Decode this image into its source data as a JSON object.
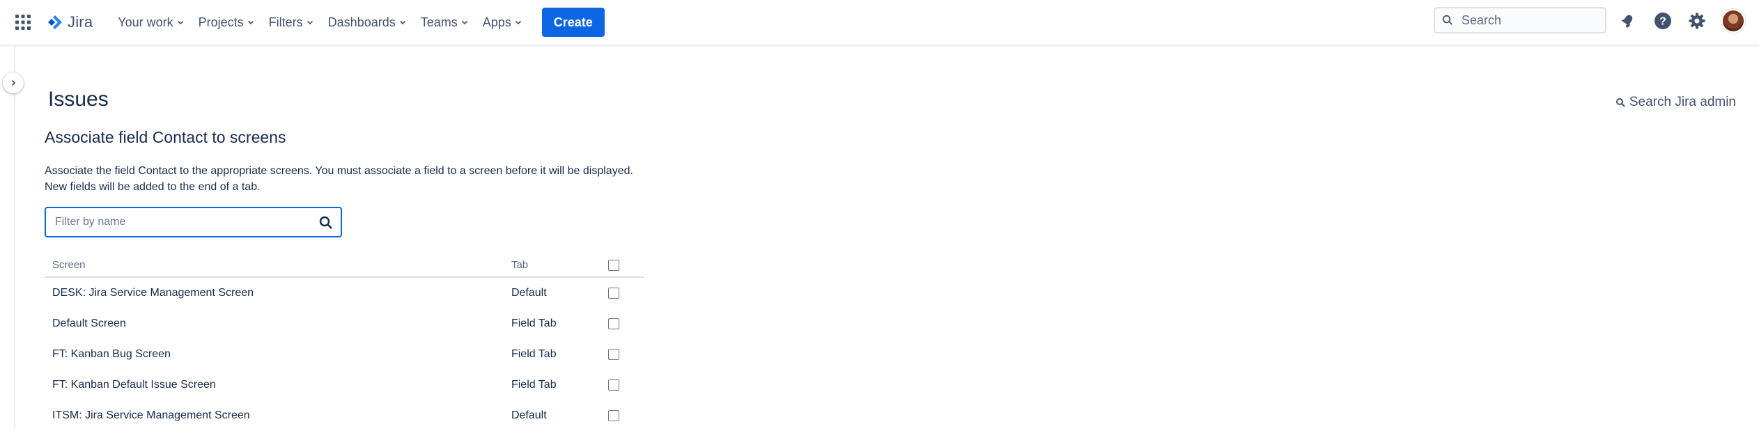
{
  "nav": {
    "logo": "Jira",
    "items": [
      {
        "label": "Your work"
      },
      {
        "label": "Projects"
      },
      {
        "label": "Filters"
      },
      {
        "label": "Dashboards"
      },
      {
        "label": "Teams"
      },
      {
        "label": "Apps"
      }
    ],
    "create_label": "Create",
    "search_placeholder": "Search"
  },
  "page": {
    "title": "Issues",
    "admin_search": "Search Jira admin",
    "section_title": "Associate field Contact to screens",
    "description_line1": "Associate the field Contact to the appropriate screens. You must associate a field to a screen before it will be displayed.",
    "description_line2": "New fields will be added to the end of a tab.",
    "filter_placeholder": "Filter by name"
  },
  "table": {
    "headers": {
      "screen": "Screen",
      "tab": "Tab"
    },
    "rows": [
      {
        "screen": "DESK: Jira Service Management Screen",
        "tab": "Default",
        "checked": false
      },
      {
        "screen": "Default Screen",
        "tab": "Field Tab",
        "checked": false
      },
      {
        "screen": "FT: Kanban Bug Screen",
        "tab": "Field Tab",
        "checked": false
      },
      {
        "screen": "FT: Kanban Default Issue Screen",
        "tab": "Field Tab",
        "checked": false
      },
      {
        "screen": "ITSM: Jira Service Management Screen",
        "tab": "Default",
        "checked": false
      }
    ]
  },
  "colors": {
    "primary": "#0c66e4",
    "text": "#172b4d",
    "subtle": "#42526e"
  },
  "icons": [
    "app-switcher-icon",
    "jira-logo-icon",
    "chevron-down-icon",
    "search-icon",
    "notifications-icon",
    "help-icon",
    "settings-icon",
    "chevron-right-icon"
  ]
}
